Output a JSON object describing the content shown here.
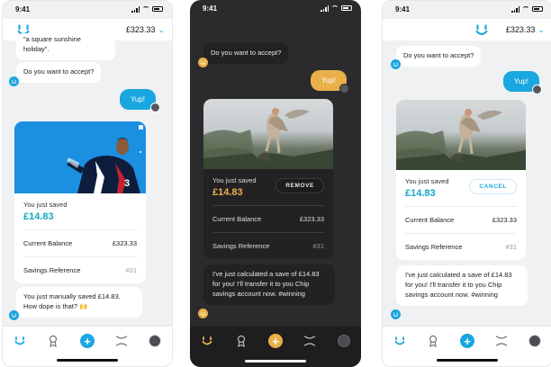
{
  "status": {
    "time": "9:41"
  },
  "header": {
    "balance": "£323.33"
  },
  "phone1": {
    "quote_tail": "\"a square sunshine holiday\".",
    "question": "Do you want to accept?",
    "reply": "Yup!",
    "saved_label": "You just saved",
    "saved_amount": "£14.83",
    "current_balance_label": "Current Balance",
    "current_balance_value": "£323.33",
    "savings_ref_label": "Savings Reference",
    "savings_ref_value": "#31",
    "manual_message": "You just manually saved £14.83. How dope is that? 🙌"
  },
  "phone2": {
    "question": "Do you want to accept?",
    "reply": "Yup!",
    "saved_label": "You just saved",
    "saved_amount": "£14.83",
    "action_label": "REMOVE",
    "current_balance_label": "Current Balance",
    "current_balance_value": "£323.33",
    "savings_ref_label": "Savings Reference",
    "savings_ref_value": "#31",
    "calc_message": "I've just calculated a save of £14.83 for you! I'll transfer it to you Chip savings account now. #winning"
  },
  "phone3": {
    "question": "Do you want to accept?",
    "reply": "Yup!",
    "saved_label": "You just saved",
    "saved_amount": "£14.83",
    "action_label": "CANCEL",
    "current_balance_label": "Current Balance",
    "current_balance_value": "£323.33",
    "savings_ref_label": "Savings Reference",
    "savings_ref_value": "#31",
    "calc_message": "I've just calculated a save of £14.83 for you! I'll transfer it to you Chip savings account now. #winning"
  },
  "tabs": [
    "chip-home-icon",
    "award-icon",
    "add-save-icon",
    "savings-icon",
    "profile-avatar"
  ],
  "colors": {
    "light_accent": "#1aa6e0",
    "dark_accent": "#e9b04a",
    "amount_teal": "#12a7c4",
    "dark_bg": "#2b2b2d"
  }
}
